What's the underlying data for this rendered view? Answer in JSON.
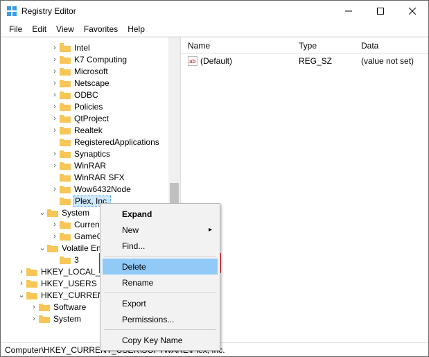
{
  "window": {
    "title": "Registry Editor"
  },
  "menu": {
    "file": "File",
    "edit": "Edit",
    "view": "View",
    "favorites": "Favorites",
    "help": "Help"
  },
  "tree": {
    "items": [
      "Intel",
      "K7 Computing",
      "Microsoft",
      "Netscape",
      "ODBC",
      "Policies",
      "QtProject",
      "Realtek",
      "RegisteredApplications",
      "Synaptics",
      "WinRAR",
      "WinRAR SFX",
      "Wow6432Node"
    ],
    "selected": "Plex, Inc.",
    "system": {
      "label": "System",
      "children": [
        "CurrentControlSet",
        "GameConfigStore"
      ]
    },
    "volatile": {
      "label": "Volatile Environment",
      "child": "3"
    },
    "roots": [
      "HKEY_LOCAL_MACHINE",
      "HKEY_USERS",
      "HKEY_CURRENT_CONFIG"
    ],
    "root_children": [
      "Software",
      "System"
    ]
  },
  "columns": {
    "name": "Name",
    "type": "Type",
    "data": "Data"
  },
  "row": {
    "name": "(Default)",
    "type": "REG_SZ",
    "data": "(value not set)"
  },
  "context": {
    "expand": "Expand",
    "new": "New",
    "find": "Find...",
    "delete": "Delete",
    "rename": "Rename",
    "export": "Export",
    "permissions": "Permissions...",
    "copy": "Copy Key Name"
  },
  "status": "Computer\\HKEY_CURRENT_USER\\SOFTWARE\\Plex, Inc.",
  "icons": {
    "chev_right": "›",
    "chev_down": "⌄",
    "submenu": "▸"
  }
}
